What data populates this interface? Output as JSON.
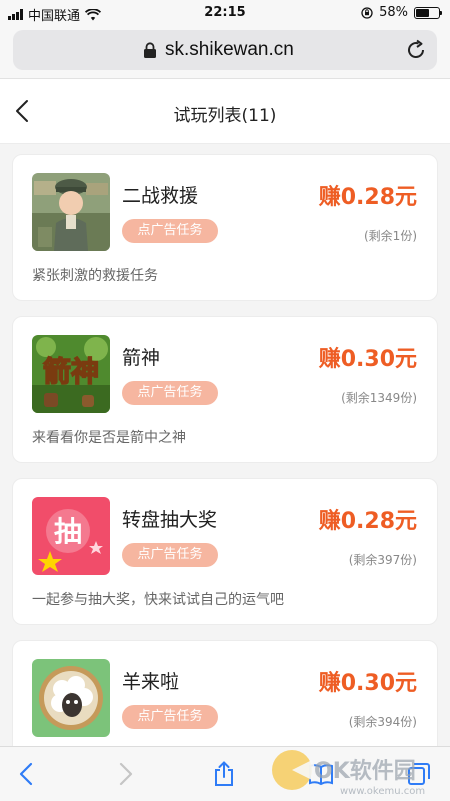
{
  "status_bar": {
    "carrier": "中国联通",
    "time": "22:15",
    "battery_pct": "58%",
    "battery_level": 0.58
  },
  "browser": {
    "url": "sk.shikewan.cn"
  },
  "header": {
    "title": "试玩列表(11)"
  },
  "items": [
    {
      "name": "二战救援",
      "tag": "点广告任务",
      "reward": "赚0.28元",
      "remaining": "(剩余1份)",
      "desc": "紧张刺激的救援任务",
      "icon": "soldier-game-icon"
    },
    {
      "name": "箭神",
      "tag": "点广告任务",
      "reward": "赚0.30元",
      "remaining": "(剩余1349份)",
      "desc": "来看看你是否是箭中之神",
      "icon": "archer-game-icon",
      "icon_text": "箭神"
    },
    {
      "name": "转盘抽大奖",
      "tag": "点广告任务",
      "reward": "赚0.28元",
      "remaining": "(剩余397份)",
      "desc": "一起参与抽大奖，快来试试自己的运气吧",
      "icon": "lottery-game-icon",
      "icon_text": "抽"
    },
    {
      "name": "羊来啦",
      "tag": "点广告任务",
      "reward": "赚0.30元",
      "remaining": "(剩余394份)",
      "desc": "",
      "icon": "sheep-game-icon"
    }
  ],
  "watermark": {
    "brand": "OK软件园",
    "domain": "www.okemu.com"
  },
  "colors": {
    "accent": "#ee5d24",
    "badge": "#f6b6a0",
    "ios_blue": "#2f7cf6"
  }
}
